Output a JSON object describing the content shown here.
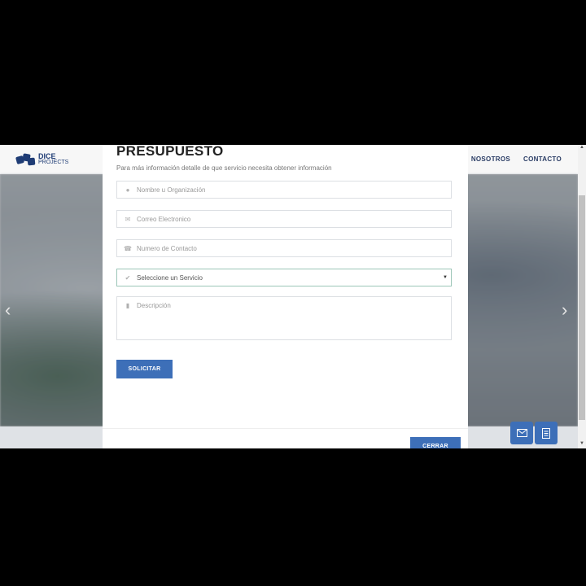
{
  "header": {
    "logo_line1": "DICE",
    "logo_line2": "PROJECTS",
    "nav": [
      "NOSOTROS",
      "CONTACTO"
    ]
  },
  "hero": {
    "prev_icon": "chevron-left-icon",
    "next_icon": "chevron-right-icon"
  },
  "floating_buttons": [
    {
      "icon": "envelope-icon"
    },
    {
      "icon": "document-icon"
    }
  ],
  "modal": {
    "title": "PRESUPUESTO",
    "subtitle": "Para más información detalle de que servicio necesita obtener información",
    "fields": {
      "name_placeholder": "Nombre u Organización",
      "email_placeholder": "Correo Electronico",
      "phone_placeholder": "Numero de Contacto",
      "service_selected": "Seleccione un Servicio",
      "description_placeholder": "Descripción"
    },
    "submit_label": "SOLICITAR",
    "close_label": "CERRAR"
  },
  "colors": {
    "accent": "#3d6fb8",
    "brand": "#1f3c75"
  }
}
